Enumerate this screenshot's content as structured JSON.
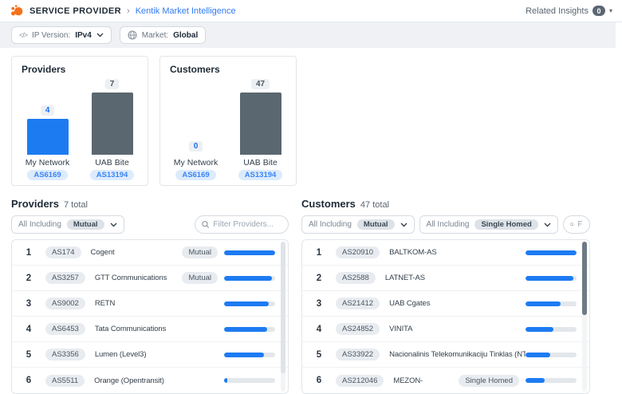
{
  "header": {
    "app_title": "SERVICE PROVIDER",
    "breadcrumb_separator": "›",
    "page_link": "Kentik Market Intelligence",
    "related_insights_label": "Related Insights",
    "related_insights_count": "0"
  },
  "filters": {
    "ip_version_icon": "</>",
    "ip_version_label": "IP Version:",
    "ip_version_value": "IPv4",
    "market_label": "Market:",
    "market_value": "Global"
  },
  "colors": {
    "accent_blue": "#1d7bf2",
    "slate_bar": "#5b6770",
    "asn_pill_bg": "#dcebfd",
    "asn_pill_text": "#3c85f4",
    "filter_bar_bg": "#eff1f4"
  },
  "chart_data": [
    {
      "type": "bar",
      "title": "Providers",
      "categories": [
        "My Network",
        "UAB Bite"
      ],
      "as_numbers": [
        "AS6169",
        "AS13194"
      ],
      "values": [
        4,
        7
      ],
      "ylim": [
        0,
        7
      ],
      "bar_colors": [
        "#1d7bf2",
        "#5b6770"
      ],
      "value_colors": [
        "#1d6ef2",
        "#4a5663"
      ],
      "grid": "off",
      "legend": "none"
    },
    {
      "type": "bar",
      "title": "Customers",
      "categories": [
        "My Network",
        "UAB Bite"
      ],
      "as_numbers": [
        "AS6169",
        "AS13194"
      ],
      "values": [
        0,
        47
      ],
      "ylim": [
        0,
        47
      ],
      "bar_colors": [
        "#1d7bf2",
        "#5b6770"
      ],
      "value_colors": [
        "#1d6ef2",
        "#4a5663"
      ],
      "grid": "off",
      "legend": "none"
    }
  ],
  "providers_table": {
    "title": "Providers",
    "total_label": "7 total",
    "filter": {
      "label": "All Including",
      "badge": "Mutual"
    },
    "search_placeholder": "Filter Providers...",
    "rows": [
      {
        "rank": "1",
        "asn": "AS174",
        "name": "Cogent",
        "badge": "Mutual",
        "bar_pct": 100
      },
      {
        "rank": "2",
        "asn": "AS3257",
        "name": "GTT Communications",
        "badge": "Mutual",
        "bar_pct": 93
      },
      {
        "rank": "3",
        "asn": "AS9002",
        "name": "RETN",
        "badge": "",
        "bar_pct": 88
      },
      {
        "rank": "4",
        "asn": "AS6453",
        "name": "Tata Communications",
        "badge": "",
        "bar_pct": 84
      },
      {
        "rank": "5",
        "asn": "AS3356",
        "name": "Lumen (Level3)",
        "badge": "",
        "bar_pct": 78
      },
      {
        "rank": "6",
        "asn": "AS5511",
        "name": "Orange (Opentransit)",
        "badge": "",
        "bar_pct": 7
      }
    ]
  },
  "customers_table": {
    "title": "Customers",
    "total_label": "47 total",
    "filters": [
      {
        "label": "All Including",
        "badge": "Mutual"
      },
      {
        "label": "All Including",
        "badge": "Single Homed"
      }
    ],
    "search_placeholder": "Filter Customers...",
    "rows": [
      {
        "rank": "1",
        "asn": "AS20910",
        "name": "BALTKOM-AS",
        "badge": "",
        "bar_pct": 100
      },
      {
        "rank": "2",
        "asn": "AS2588",
        "name": "LATNET-AS",
        "badge": "",
        "bar_pct": 94
      },
      {
        "rank": "3",
        "asn": "AS21412",
        "name": "UAB Cgates",
        "badge": "",
        "bar_pct": 68
      },
      {
        "rank": "4",
        "asn": "AS24852",
        "name": "VINITA",
        "badge": "",
        "bar_pct": 55
      },
      {
        "rank": "5",
        "asn": "AS33922",
        "name": "Nacionalinis Telekomunikaciju Tinklas (NTT)",
        "badge": "",
        "bar_pct": 48
      },
      {
        "rank": "6",
        "asn": "AS212046",
        "name": "MEZON-",
        "badge": "Single Homed",
        "bar_pct": 38
      }
    ]
  }
}
